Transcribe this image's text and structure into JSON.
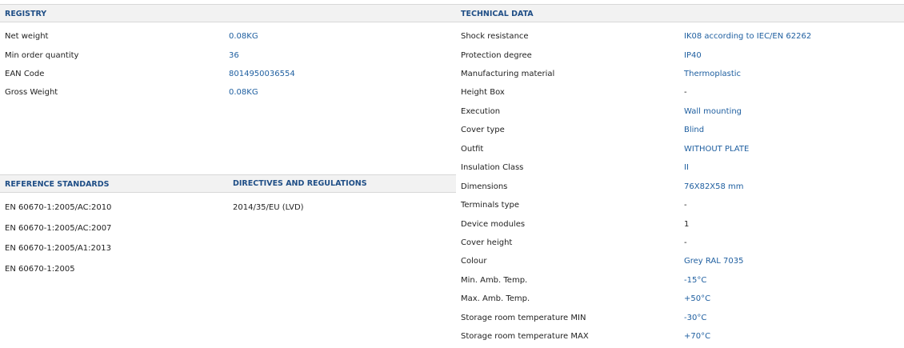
{
  "registry": {
    "title": "REGISTRY",
    "rows": [
      {
        "label": "Net weight",
        "value": "0.08KG"
      },
      {
        "label": "Min order quantity",
        "value": "36"
      },
      {
        "label": "EAN Code",
        "value": "8014950036554"
      },
      {
        "label": "Gross Weight",
        "value": "0.08KG"
      }
    ]
  },
  "reference_standards": {
    "title": "REFERENCE STANDARDS",
    "items": [
      "EN 60670-1:2005/AC:2010",
      "EN 60670-1:2005/AC:2007",
      "EN 60670-1:2005/A1:2013",
      "EN 60670-1:2005"
    ]
  },
  "directives": {
    "title": "DIRECTIVES AND REGULATIONS",
    "items": [
      "2014/35/EU (LVD)"
    ]
  },
  "technical_data": {
    "title": "TECHNICAL DATA",
    "rows": [
      {
        "label": "Shock resistance",
        "value": "IK08 according to IEC/EN 62262"
      },
      {
        "label": "Protection degree",
        "value": "IP40"
      },
      {
        "label": "Manufacturing material",
        "value": "Thermoplastic"
      },
      {
        "label": "Height Box",
        "value": "-"
      },
      {
        "label": "Execution",
        "value": "Wall mounting"
      },
      {
        "label": "Cover type",
        "value": "Blind"
      },
      {
        "label": "Outfit",
        "value": "WITHOUT PLATE"
      },
      {
        "label": "Insulation Class",
        "value": "II"
      },
      {
        "label": "Dimensions",
        "value": "76X82X58 mm"
      },
      {
        "label": "Terminals type",
        "value": "-"
      },
      {
        "label": "Device modules",
        "value": "1"
      },
      {
        "label": "Cover height",
        "value": "-"
      },
      {
        "label": "Colour",
        "value": "Grey RAL 7035"
      },
      {
        "label": "Min. Amb. Temp.",
        "value": "-15°C"
      },
      {
        "label": "Max. Amb. Temp.",
        "value": "+50°C"
      },
      {
        "label": "Storage room temperature MIN",
        "value": "-30°C"
      },
      {
        "label": "Storage room temperature MAX",
        "value": "+70°C"
      }
    ]
  }
}
